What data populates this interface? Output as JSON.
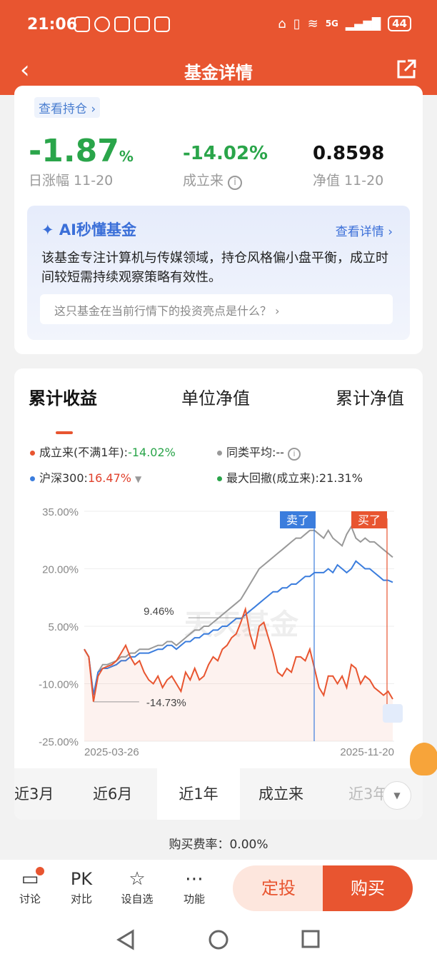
{
  "status": {
    "time": "21:06",
    "network": "5G",
    "battery": "44"
  },
  "nav": {
    "title": "基金详情"
  },
  "summary": {
    "view_holdings": "查看持仓 ›",
    "daily_change": "-1.87",
    "daily_change_unit": "%",
    "daily_label": "日涨幅 11-20",
    "since_inception": "-14.02%",
    "since_label": "成立来",
    "nav_value": "0.8598",
    "nav_label": "净值 11-20"
  },
  "ai": {
    "title": "AI秒懂基金",
    "more": "查看详情 ›",
    "desc": "该基金专注计算机与传媒领域，持仓风格偏小盘平衡，成立时间较短需持续观察策略有效性。",
    "question": "这只基金在当前行情下的投资亮点是什么？ ›"
  },
  "tabs": [
    "累计收益",
    "单位净值",
    "累计净值"
  ],
  "legend": {
    "fund_label": "成立来(不满1年):",
    "fund_value": "-14.02%",
    "peer_label": "同类平均:",
    "peer_value": "--",
    "index_label": "沪深300:",
    "index_value": "16.47%",
    "mdd_label": "最大回撤(成立来):",
    "mdd_value": "21.31%"
  },
  "chart_data": {
    "type": "line",
    "x_start": "2025-03-26",
    "x_end": "2025-11-20",
    "yticks": [
      "35.00%",
      "20.00%",
      "5.00%",
      "-10.00%",
      "-25.00%"
    ],
    "ylim": [
      -25,
      35
    ],
    "annotations": {
      "high": "9.46%",
      "low": "-14.73%",
      "sell": "卖了",
      "buy": "买了",
      "watermark": "天天基金"
    },
    "series": [
      {
        "name": "成立来",
        "color": "#e85530",
        "values": [
          -1,
          -3,
          -14.7,
          -8,
          -6,
          -5.5,
          -5,
          -4,
          -2,
          0,
          -3,
          -5,
          -4,
          -7,
          -9,
          -10,
          -8,
          -11,
          -9,
          -8,
          -10,
          -12,
          -7,
          -9,
          -6,
          -9,
          -8,
          -5,
          -3,
          -4,
          -1,
          0,
          2,
          3,
          6,
          9.46,
          3,
          -1,
          5,
          6,
          2,
          -2,
          -7,
          -8,
          -6,
          -7,
          -3,
          -3,
          -4,
          -1,
          -6,
          -11,
          -13,
          -8,
          -8,
          -10,
          -8,
          -11,
          -5,
          -6,
          -10,
          -8,
          -9,
          -11,
          -12,
          -13,
          -12,
          -14
        ]
      },
      {
        "name": "沪深300",
        "color": "#3b7ddd",
        "values": [
          -1,
          -3,
          -13,
          -7,
          -6,
          -6,
          -5.5,
          -5,
          -4,
          -4,
          -3,
          -3,
          -2,
          -2,
          -2,
          -1.5,
          -1,
          -1,
          0,
          0,
          -1,
          0,
          1,
          1,
          2,
          2,
          3,
          3,
          4,
          4,
          5,
          5,
          6,
          7,
          7,
          8,
          9,
          10,
          11,
          12,
          13,
          14,
          14,
          15,
          15,
          16,
          16,
          17,
          18,
          18,
          19,
          19,
          19,
          20,
          19,
          21,
          20,
          19,
          20,
          22,
          21,
          20,
          20,
          19,
          18,
          17,
          17,
          16.47
        ]
      },
      {
        "name": "同类平均",
        "color": "#999999",
        "values": [
          -1,
          -3,
          -13,
          -7,
          -5,
          -5,
          -4.5,
          -4,
          -3,
          -3,
          -2,
          -2,
          -1,
          -1,
          -1,
          -0.5,
          0,
          0,
          1,
          1,
          0,
          1,
          2,
          3,
          4,
          4,
          5,
          5,
          6,
          7,
          8,
          9,
          10,
          11,
          12,
          14,
          16,
          18,
          20,
          21,
          22,
          23,
          24,
          25,
          26,
          27,
          28,
          28,
          29,
          30,
          30,
          29,
          28,
          30,
          28,
          27,
          26,
          29,
          31,
          28,
          27,
          28,
          27,
          27,
          26,
          25,
          24,
          23
        ]
      }
    ]
  },
  "periods": [
    "近3月",
    "近6月",
    "近1年",
    "成立来",
    "近3年"
  ],
  "fee": "购买费率：0.00%",
  "bottom": {
    "discuss": "讨论",
    "pk_icon": "PK",
    "pk": "对比",
    "watch": "设自选",
    "func": "功能",
    "dingtou": "定投",
    "buy": "购买"
  }
}
